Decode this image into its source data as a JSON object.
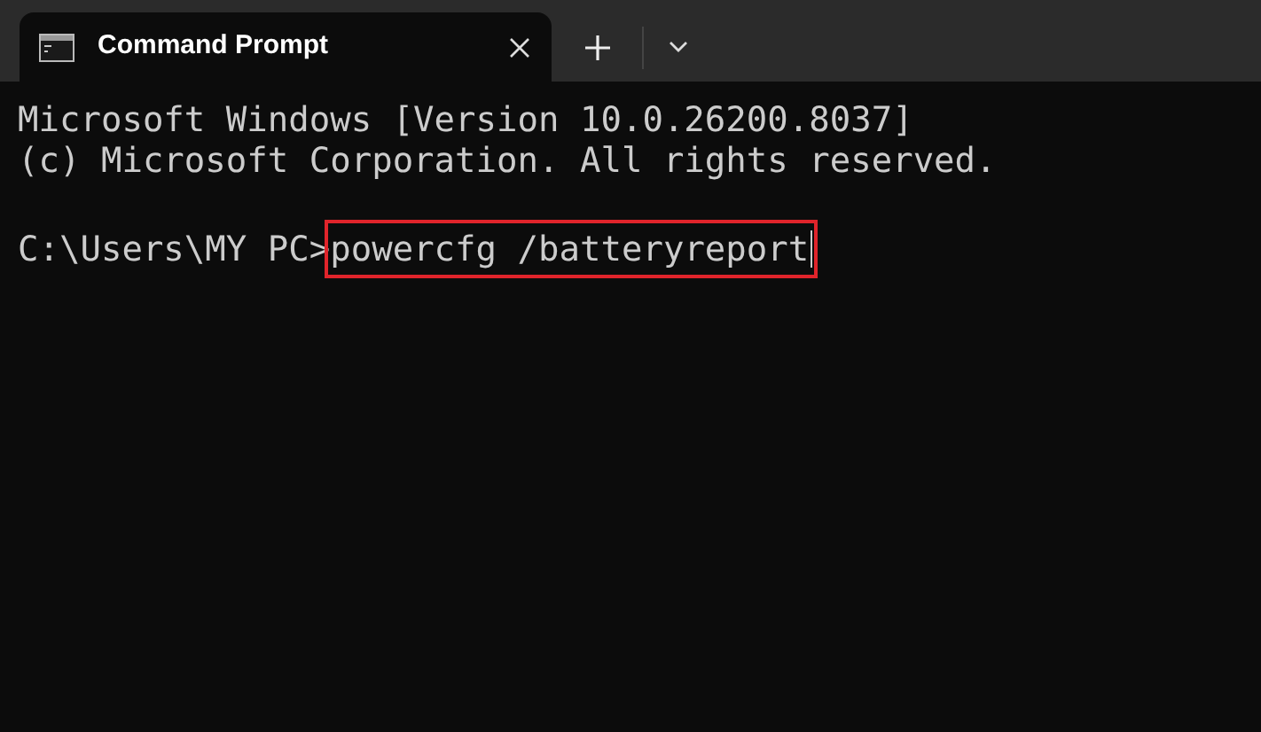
{
  "tab": {
    "title": "Command Prompt",
    "selected": true
  },
  "output_lines": [
    "Microsoft Windows [Version 10.0.26200.8037]",
    "(c) Microsoft Corporation. All rights reserved."
  ],
  "prompt": {
    "path": "C:\\Users\\MY PC>",
    "command": "powercfg /batteryreport",
    "highlighted": true
  }
}
